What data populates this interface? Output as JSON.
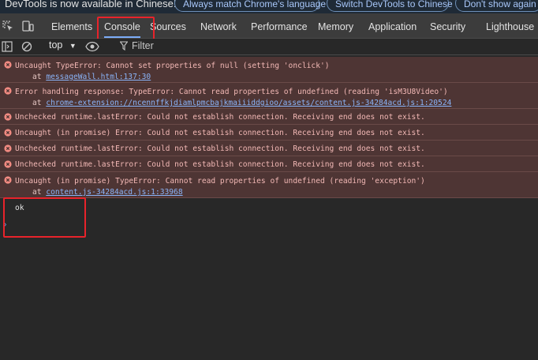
{
  "infobar": {
    "message": "DevTools is now available in Chinese!",
    "buttons": [
      "Always match Chrome's language",
      "Switch DevTools to Chinese",
      "Don't show again"
    ]
  },
  "tabs": [
    "Elements",
    "Console",
    "Sources",
    "Network",
    "Performance",
    "Memory",
    "Application",
    "Security",
    "Lighthouse"
  ],
  "active_tab": "Console",
  "toolbar": {
    "context": "top",
    "filter_placeholder": "Filter"
  },
  "messages": [
    {
      "text": "Uncaught TypeError: Cannot set properties of null (setting 'onclick')",
      "at_prefix": "at ",
      "location": "messageWall.html:137:30"
    },
    {
      "text": "Error handling response: TypeError: Cannot read properties of undefined (reading 'isM3U8Video')",
      "at_prefix": "at ",
      "location": "chrome-extension://ncennffkjdiamlpmcbajkmaiiiddgioo/assets/content.js-34284acd.js:1:20524"
    },
    {
      "text": "Unchecked runtime.lastError: Could not establish connection. Receiving end does not exist."
    },
    {
      "text": "Uncaught (in promise) Error: Could not establish connection. Receiving end does not exist."
    },
    {
      "text": "Unchecked runtime.lastError: Could not establish connection. Receiving end does not exist."
    },
    {
      "text": "Unchecked runtime.lastError: Could not establish connection. Receiving end does not exist."
    },
    {
      "text": "Uncaught (in promise) TypeError: Cannot read properties of undefined (reading 'exception')",
      "at_prefix": "at ",
      "location": "content.js-34284acd.js:1:33968"
    }
  ],
  "log_output": "ok",
  "prompt": "›",
  "colors": {
    "error_bg": "#4e3534",
    "error_text": "#f2b8b5",
    "link": "#8ab4f8",
    "highlight": "#e8232b",
    "accent": "#7cacf8"
  }
}
